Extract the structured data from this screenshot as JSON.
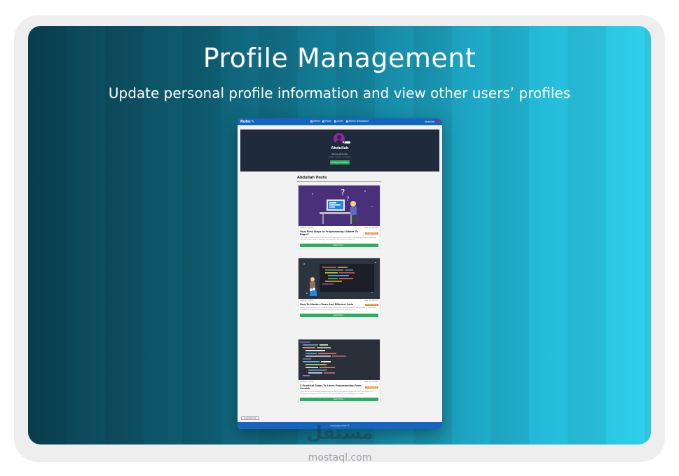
{
  "hero": {
    "title": "Profile Management",
    "subtitle": "Update personal profile information and view other users’ profiles"
  },
  "app": {
    "logo": "Rubu",
    "nav": [
      {
        "label": "Home",
        "icon": "home-icon"
      },
      {
        "label": "Posts",
        "icon": "posts-icon"
      },
      {
        "label": "Users",
        "icon": "users-icon"
      },
      {
        "label": "Admin Dashboard",
        "icon": "dashboard-icon"
      }
    ],
    "user_label": "Abdullah",
    "profile": {
      "name": "Abdullah",
      "username": "Name abdullah",
      "meta": "Date • Joined • Location",
      "edit_button": "Edit your Profile"
    },
    "posts_heading": "Abdullah Posts",
    "posts": [
      {
        "author": "Abdullah • Author",
        "date": "Date: Apr 06 2025",
        "title": "Your First Steps In Programming: Where To Begin?",
        "tag": "Programming",
        "excerpt": "The world of programming is vast and full of opportunities, but finding a starting point can be confusing. This post is your guide to choosing the right path. We'll cover the basics of",
        "button": "Read More..."
      },
      {
        "author": "Abdullah • Author",
        "date": "Date: Apr 06 2025",
        "title": "How To Master Clean And Efficient Code",
        "tag": "Programming",
        "excerpt": "Writing code that works is the first step, but writing clean, efficient code is what separates a novice from an expert. In this post we'll share practical tips to make your code easier to",
        "button": "Read More..."
      },
      {
        "author": "Abdullah • Author",
        "date": "Date: Apr 06 2025",
        "title": "5 Practical Steps To Learn Programming From Scratch",
        "tag": "Programming",
        "excerpt": "If you want to start learning programming but don't know where to begin, this article will guide you through a few simple and clear steps to get you on the way to a building your first code.",
        "button": "Read More..."
      }
    ],
    "side_button": "Create New Post",
    "footer": "Copyright 2025 ©"
  },
  "watermark": {
    "arabic": "مستقل",
    "latin": "mostaql.com"
  },
  "colors": {
    "nav": "#1565c0",
    "accent_green": "#27ae60",
    "tag_orange": "#e67e22",
    "banner": "#1f2a3a"
  }
}
